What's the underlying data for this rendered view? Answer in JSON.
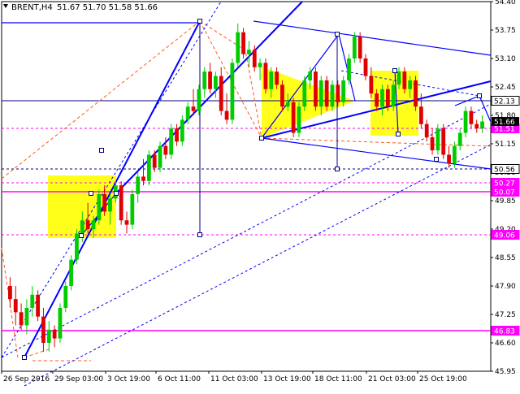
{
  "header": {
    "symbol_label": "BRENT,H4",
    "ohlc_label": "51.67 51.70 51.58 51.66"
  },
  "colors": {
    "bull": "#00cc00",
    "bear": "#e00000",
    "trend": "#0000ff",
    "dashed_red": "#ff5a1a",
    "magenta": "#ff00ff",
    "pattern": "#ffff00"
  },
  "chart_data": {
    "type": "candlestick",
    "title": "BRENT,H4",
    "ylim": [
      45.95,
      54.4
    ],
    "y_ticks": [
      "54.40",
      "53.75",
      "53.10",
      "52.45",
      "51.80",
      "51.15",
      "50.50",
      "49.85",
      "49.20",
      "48.55",
      "47.90",
      "47.25",
      "46.60",
      "45.95"
    ],
    "x_ticks": [
      "26 Sep 2016",
      "29 Sep 03:00",
      "3 Oct 19:00",
      "6 Oct 11:00",
      "11 Oct 03:00",
      "13 Oct 19:00",
      "18 Oct 11:00",
      "21 Oct 03:00",
      "25 Oct 19:00"
    ],
    "current_price_tag": "51.66",
    "level_tags": [
      {
        "value": 52.13,
        "label": "52.13",
        "style": "plain"
      },
      {
        "value": 51.51,
        "label": "51.51",
        "style": "magenta"
      },
      {
        "value": 50.56,
        "label": "50.56",
        "style": "plain"
      },
      {
        "value": 50.27,
        "label": "50.27",
        "style": "magenta"
      },
      {
        "value": 50.07,
        "label": "50.07",
        "style": "magenta"
      },
      {
        "value": 49.06,
        "label": "49.06",
        "style": "magenta"
      },
      {
        "value": 46.83,
        "label": "46.83",
        "style": "magenta"
      }
    ],
    "candles": [
      [
        47.9,
        48.1,
        47.4,
        47.6
      ],
      [
        47.6,
        47.9,
        47.0,
        47.3
      ],
      [
        47.3,
        47.5,
        46.9,
        47.0
      ],
      [
        47.0,
        47.6,
        46.8,
        47.4
      ],
      [
        47.4,
        47.9,
        47.2,
        47.7
      ],
      [
        47.7,
        47.8,
        47.1,
        47.2
      ],
      [
        47.2,
        47.4,
        46.4,
        46.6
      ],
      [
        46.6,
        47.1,
        46.4,
        46.9
      ],
      [
        46.9,
        47.0,
        46.5,
        46.7
      ],
      [
        46.7,
        47.5,
        46.6,
        47.4
      ],
      [
        47.4,
        48.0,
        47.3,
        47.9
      ],
      [
        47.9,
        48.6,
        47.8,
        48.5
      ],
      [
        48.5,
        49.2,
        48.4,
        49.1
      ],
      [
        49.1,
        49.6,
        48.9,
        49.4
      ],
      [
        49.4,
        49.8,
        49.1,
        49.2
      ],
      [
        49.2,
        49.5,
        49.0,
        49.4
      ],
      [
        49.4,
        50.1,
        49.3,
        50.0
      ],
      [
        50.0,
        50.2,
        49.5,
        49.6
      ],
      [
        49.6,
        50.0,
        49.3,
        49.9
      ],
      [
        49.9,
        50.3,
        49.8,
        50.2
      ],
      [
        50.2,
        50.3,
        49.3,
        49.4
      ],
      [
        49.4,
        49.6,
        49.1,
        49.3
      ],
      [
        49.3,
        50.1,
        49.2,
        50.0
      ],
      [
        50.0,
        50.5,
        49.8,
        50.4
      ],
      [
        50.4,
        50.8,
        50.2,
        50.3
      ],
      [
        50.3,
        51.0,
        50.2,
        50.9
      ],
      [
        50.9,
        51.0,
        50.5,
        50.6
      ],
      [
        50.6,
        51.2,
        50.5,
        51.1
      ],
      [
        51.1,
        51.3,
        50.8,
        50.9
      ],
      [
        50.9,
        51.6,
        50.8,
        51.5
      ],
      [
        51.5,
        51.6,
        51.1,
        51.2
      ],
      [
        51.2,
        51.8,
        51.1,
        51.7
      ],
      [
        51.7,
        52.1,
        51.6,
        52.0
      ],
      [
        52.0,
        52.4,
        51.8,
        51.9
      ],
      [
        51.9,
        52.5,
        51.8,
        52.4
      ],
      [
        52.4,
        52.9,
        52.2,
        52.8
      ],
      [
        52.8,
        53.0,
        52.3,
        52.4
      ],
      [
        52.4,
        52.8,
        52.2,
        52.7
      ],
      [
        52.7,
        52.9,
        51.8,
        51.9
      ],
      [
        51.9,
        52.3,
        51.6,
        51.7
      ],
      [
        51.7,
        53.1,
        51.6,
        53.0
      ],
      [
        53.0,
        53.9,
        52.9,
        53.7
      ],
      [
        53.7,
        53.8,
        53.1,
        53.2
      ],
      [
        53.2,
        53.5,
        52.9,
        53.3
      ],
      [
        53.3,
        53.4,
        52.8,
        52.9
      ],
      [
        52.9,
        53.1,
        52.6,
        53.0
      ],
      [
        53.0,
        53.1,
        52.3,
        52.4
      ],
      [
        52.4,
        52.9,
        52.2,
        52.8
      ],
      [
        52.8,
        52.9,
        52.4,
        52.5
      ],
      [
        52.5,
        52.6,
        51.9,
        52.0
      ],
      [
        52.0,
        52.3,
        51.9,
        52.1
      ],
      [
        52.1,
        52.2,
        51.3,
        51.4
      ],
      [
        51.4,
        52.1,
        51.3,
        52.0
      ],
      [
        52.0,
        52.7,
        51.9,
        52.6
      ],
      [
        52.6,
        52.9,
        52.4,
        52.8
      ],
      [
        52.8,
        52.9,
        51.9,
        52.0
      ],
      [
        52.0,
        52.7,
        51.8,
        52.6
      ],
      [
        52.6,
        52.7,
        51.9,
        52.0
      ],
      [
        52.0,
        52.6,
        51.9,
        52.5
      ],
      [
        52.5,
        52.6,
        52.0,
        52.1
      ],
      [
        52.1,
        52.7,
        52.0,
        52.6
      ],
      [
        52.6,
        53.2,
        52.5,
        53.1
      ],
      [
        53.1,
        53.7,
        53.0,
        53.6
      ],
      [
        53.6,
        53.7,
        53.0,
        53.1
      ],
      [
        53.1,
        53.2,
        52.6,
        52.7
      ],
      [
        52.7,
        52.9,
        52.2,
        52.3
      ],
      [
        52.3,
        52.4,
        51.9,
        52.0
      ],
      [
        52.0,
        52.5,
        51.8,
        52.4
      ],
      [
        52.4,
        52.5,
        51.9,
        52.0
      ],
      [
        52.0,
        52.6,
        51.9,
        52.5
      ],
      [
        52.5,
        52.9,
        52.4,
        52.8
      ],
      [
        52.8,
        52.9,
        52.3,
        52.4
      ],
      [
        52.4,
        52.7,
        52.2,
        52.6
      ],
      [
        52.6,
        52.7,
        51.9,
        52.0
      ],
      [
        52.0,
        52.3,
        51.5,
        51.6
      ],
      [
        51.6,
        51.7,
        51.2,
        51.3
      ],
      [
        51.3,
        51.5,
        50.9,
        51.0
      ],
      [
        51.0,
        51.6,
        50.9,
        51.5
      ],
      [
        51.5,
        51.6,
        50.8,
        50.9
      ],
      [
        50.9,
        51.1,
        50.6,
        50.7
      ],
      [
        50.7,
        51.2,
        50.6,
        51.1
      ],
      [
        51.1,
        51.5,
        51.0,
        51.4
      ],
      [
        51.4,
        52.0,
        51.3,
        51.9
      ],
      [
        51.9,
        52.0,
        51.5,
        51.6
      ],
      [
        51.6,
        51.7,
        51.4,
        51.5
      ],
      [
        51.5,
        51.8,
        51.4,
        51.66
      ]
    ]
  }
}
